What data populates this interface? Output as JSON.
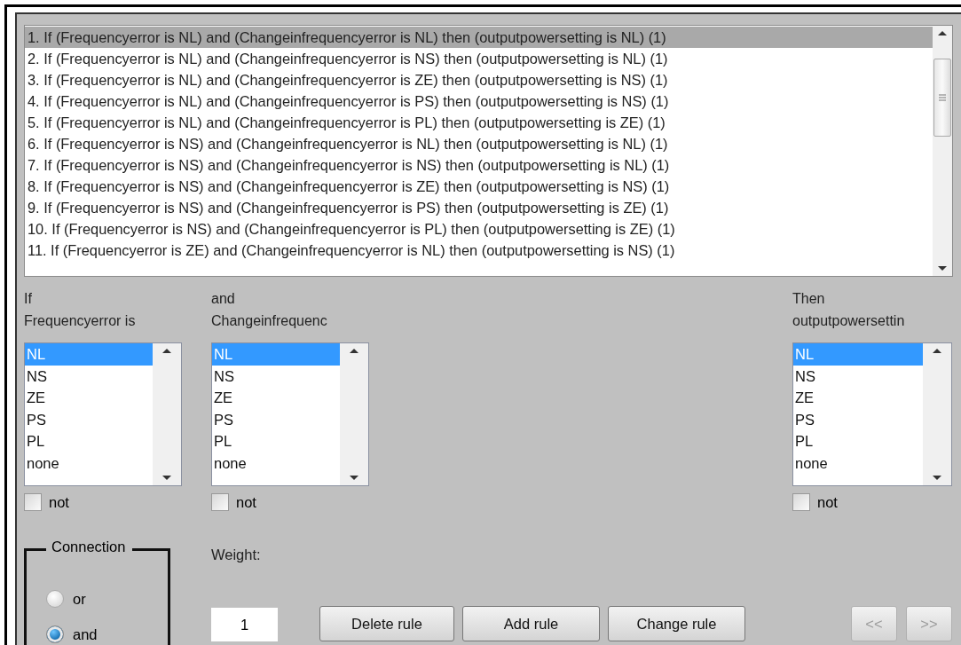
{
  "rules": [
    {
      "text": "1. If (Frequencyerror is NL) and (Changeinfrequencyerror is NL) then (outputpowersetting is NL) (1)",
      "selected": true
    },
    {
      "text": "2. If (Frequencyerror is NL) and (Changeinfrequencyerror is NS) then (outputpowersetting is NL) (1)",
      "selected": false
    },
    {
      "text": "3. If (Frequencyerror is NL) and (Changeinfrequencyerror is ZE) then (outputpowersetting is NS) (1)",
      "selected": false
    },
    {
      "text": "4. If (Frequencyerror is NL) and (Changeinfrequencyerror is PS) then (outputpowersetting is NS) (1)",
      "selected": false
    },
    {
      "text": "5. If (Frequencyerror is NL) and (Changeinfrequencyerror is PL) then (outputpowersetting is ZE) (1)",
      "selected": false
    },
    {
      "text": "6. If (Frequencyerror is NS) and (Changeinfrequencyerror is NL) then (outputpowersetting is NL) (1)",
      "selected": false
    },
    {
      "text": "7. If (Frequencyerror is NS) and (Changeinfrequencyerror is NS) then (outputpowersetting is NL) (1)",
      "selected": false
    },
    {
      "text": "8. If (Frequencyerror is NS) and (Changeinfrequencyerror is ZE) then (outputpowersetting is NS) (1)",
      "selected": false
    },
    {
      "text": "9. If (Frequencyerror is NS) and (Changeinfrequencyerror is PS) then (outputpowersetting is ZE) (1)",
      "selected": false
    },
    {
      "text": "10. If (Frequencyerror is NS) and (Changeinfrequencyerror is PL) then (outputpowersetting is ZE) (1)",
      "selected": false
    },
    {
      "text": "11. If (Frequencyerror is ZE) and (Changeinfrequencyerror is NL) then (outputpowersetting is NS) (1)",
      "selected": false
    }
  ],
  "variables": [
    {
      "kind": "input",
      "heading": "If",
      "name": "Frequencyerror is",
      "options": [
        {
          "label": "NL",
          "selected": true
        },
        {
          "label": "NS",
          "selected": false
        },
        {
          "label": "ZE",
          "selected": false
        },
        {
          "label": "PS",
          "selected": false
        },
        {
          "label": "PL",
          "selected": false
        },
        {
          "label": "none",
          "selected": false
        }
      ],
      "not": {
        "label": "not",
        "checked": false
      }
    },
    {
      "kind": "input",
      "heading": "and",
      "name": "Changeinfrequenc",
      "options": [
        {
          "label": "NL",
          "selected": true
        },
        {
          "label": "NS",
          "selected": false
        },
        {
          "label": "ZE",
          "selected": false
        },
        {
          "label": "PS",
          "selected": false
        },
        {
          "label": "PL",
          "selected": false
        },
        {
          "label": "none",
          "selected": false
        }
      ],
      "not": {
        "label": "not",
        "checked": false
      }
    },
    {
      "kind": "output",
      "heading": "Then",
      "name": "outputpowersettin",
      "options": [
        {
          "label": "NL",
          "selected": true
        },
        {
          "label": "NS",
          "selected": false
        },
        {
          "label": "ZE",
          "selected": false
        },
        {
          "label": "PS",
          "selected": false
        },
        {
          "label": "PL",
          "selected": false
        },
        {
          "label": "none",
          "selected": false
        }
      ],
      "not": {
        "label": "not",
        "checked": false
      }
    }
  ],
  "connection": {
    "title": "Connection",
    "options": [
      {
        "label": "or",
        "selected": false
      },
      {
        "label": "and",
        "selected": true
      }
    ]
  },
  "weight": {
    "label": "Weight:",
    "value": "1"
  },
  "buttons": [
    {
      "label": "Delete rule",
      "disabled": false
    },
    {
      "label": "Add rule",
      "disabled": false
    },
    {
      "label": "Change rule",
      "disabled": false
    }
  ],
  "nav_buttons": [
    {
      "label": "<<",
      "disabled": true
    },
    {
      "label": ">>",
      "disabled": true
    }
  ]
}
